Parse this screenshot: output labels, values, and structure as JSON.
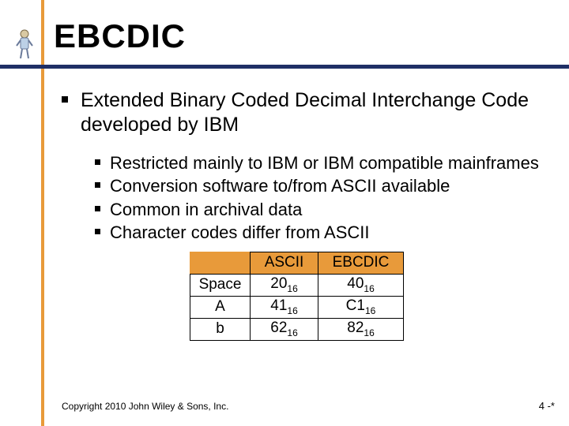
{
  "title": "EBCDIC",
  "bullets": {
    "main": "Extended Binary Coded Decimal Interchange Code developed by IBM",
    "subs": [
      "Restricted mainly to IBM or IBM compatible mainframes",
      "Conversion software to/from ASCII available",
      "Common in archival data",
      "Character codes differ from ASCII"
    ]
  },
  "table": {
    "headers": {
      "col1": "ASCII",
      "col2": "EBCDIC"
    },
    "rows": [
      {
        "label": "Space",
        "ascii_val": "20",
        "ascii_base": "16",
        "ebcdic_val": "40",
        "ebcdic_base": "16"
      },
      {
        "label": "A",
        "ascii_val": "41",
        "ascii_base": "16",
        "ebcdic_val": "C1",
        "ebcdic_base": "16"
      },
      {
        "label": "b",
        "ascii_val": "62",
        "ascii_base": "16",
        "ebcdic_val": "82",
        "ebcdic_base": "16"
      }
    ]
  },
  "footer": {
    "copyright": "Copyright 2010 John Wiley & Sons, Inc.",
    "pagenum": "4 -*"
  }
}
